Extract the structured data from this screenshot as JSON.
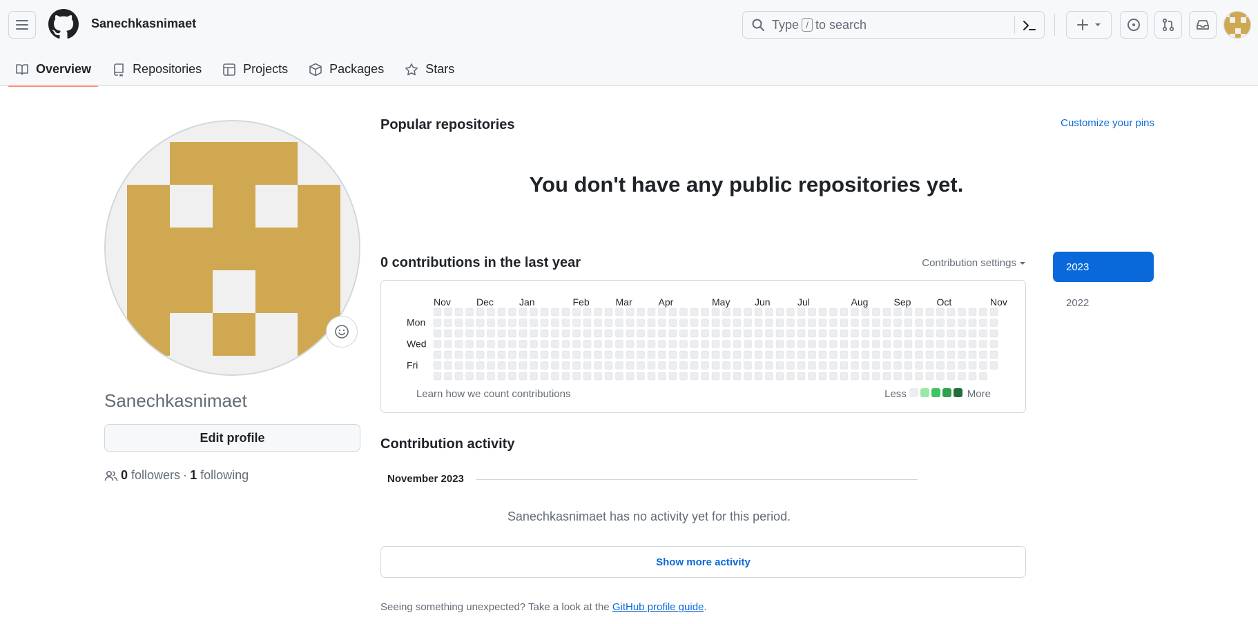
{
  "header": {
    "username": "Sanechkasnimaet",
    "search_placeholder_pre": "Type",
    "search_key": "/",
    "search_placeholder_post": "to search",
    "plus_icon": "plus-icon",
    "colors": {
      "bg": "#f6f8fa",
      "border": "#d0d7de"
    }
  },
  "tabs": [
    {
      "label": "Overview",
      "icon": "book-icon",
      "active": true
    },
    {
      "label": "Repositories",
      "icon": "repo-icon"
    },
    {
      "label": "Projects",
      "icon": "table-icon"
    },
    {
      "label": "Packages",
      "icon": "package-icon"
    },
    {
      "label": "Stars",
      "icon": "star-icon"
    }
  ],
  "profile": {
    "name": "Sanechkasnimaet",
    "edit_label": "Edit profile",
    "followers_count": "0",
    "followers_label": "followers",
    "following_count": "1",
    "following_label": "following",
    "avatar_color": "#d0a852"
  },
  "popular": {
    "title": "Popular repositories",
    "customize": "Customize your pins",
    "empty": "You don't have any public repositories yet."
  },
  "contributions": {
    "title": "0 contributions in the last year",
    "settings": "Contribution settings",
    "months": [
      "Nov",
      "Dec",
      "Jan",
      "Feb",
      "Mar",
      "Apr",
      "May",
      "Jun",
      "Jul",
      "Aug",
      "Sep",
      "Oct",
      "Nov"
    ],
    "days": [
      "Mon",
      "Wed",
      "Fri"
    ],
    "learn": "Learn how we count contributions",
    "less": "Less",
    "more": "More",
    "legend_colors": [
      "#ebedf0",
      "#9be9a8",
      "#40c463",
      "#30a14e",
      "#216e39"
    ]
  },
  "years": [
    "2023",
    "2022"
  ],
  "activity": {
    "title": "Contribution activity",
    "month": "November 2023",
    "empty": "Sanechkasnimaet has no activity yet for this period.",
    "show_more": "Show more activity",
    "note_pre": "Seeing something unexpected? Take a look at the",
    "note_link": "GitHub profile guide",
    "note_post": "."
  }
}
